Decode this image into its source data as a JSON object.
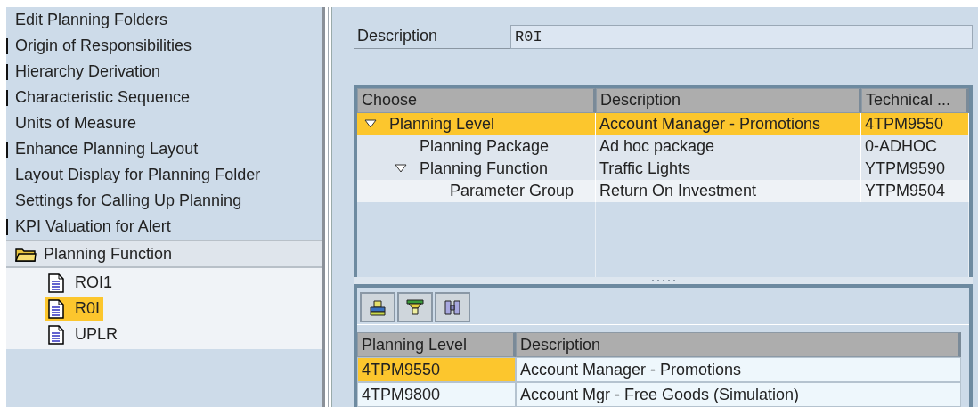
{
  "navigation": {
    "items": [
      {
        "label": "Edit Planning Folders",
        "marker": false
      },
      {
        "label": "Origin of Responsibilities",
        "marker": true
      },
      {
        "label": "Hierarchy Derivation",
        "marker": true
      },
      {
        "label": "Characteristic Sequence",
        "marker": true
      },
      {
        "label": "Units of Measure",
        "marker": false
      },
      {
        "label": "Enhance Planning Layout",
        "marker": true
      },
      {
        "label": "Layout Display for Planning Folder",
        "marker": false
      },
      {
        "label": "Settings for Calling Up Planning",
        "marker": false
      },
      {
        "label": "KPI Valuation for Alert",
        "marker": true
      }
    ],
    "folder": {
      "label": "Planning Function",
      "expanded": true,
      "children": [
        {
          "label": "ROI1",
          "selected": false
        },
        {
          "label": "R0I",
          "selected": true
        },
        {
          "label": "UPLR",
          "selected": false
        }
      ]
    }
  },
  "description": {
    "label": "Description",
    "value": "R0I"
  },
  "tree_table": {
    "columns": [
      "Choose",
      "Description",
      "Technical ..."
    ],
    "rows": [
      {
        "label": "Planning Level",
        "description": "Account Manager - Promotions",
        "technical": "4TPM9550",
        "expanded": true,
        "selected": true,
        "children": [
          {
            "label": "Planning Package",
            "description": "Ad hoc package",
            "technical": "0-ADHOC",
            "selected": false
          },
          {
            "label": "Planning Function",
            "description": "Traffic Lights",
            "technical": "YTPM9590",
            "expanded": true,
            "selected": false,
            "children": [
              {
                "label": "Parameter Group",
                "description": "Return On Investment",
                "technical": "YTPM9504",
                "selected": false
              }
            ]
          }
        ]
      }
    ]
  },
  "toolbar": [
    {
      "kind": "print"
    },
    {
      "kind": "filter"
    },
    {
      "kind": "find"
    }
  ],
  "grid": {
    "columns": [
      "Planning Level",
      "Description"
    ],
    "rows": [
      {
        "cells": [
          "4TPM9550",
          "Account Manager - Promotions"
        ],
        "selected": true
      },
      {
        "cells": [
          "4TPM9800",
          "Account Mgr - Free Goods (Simulation)"
        ],
        "selected": false
      }
    ]
  }
}
